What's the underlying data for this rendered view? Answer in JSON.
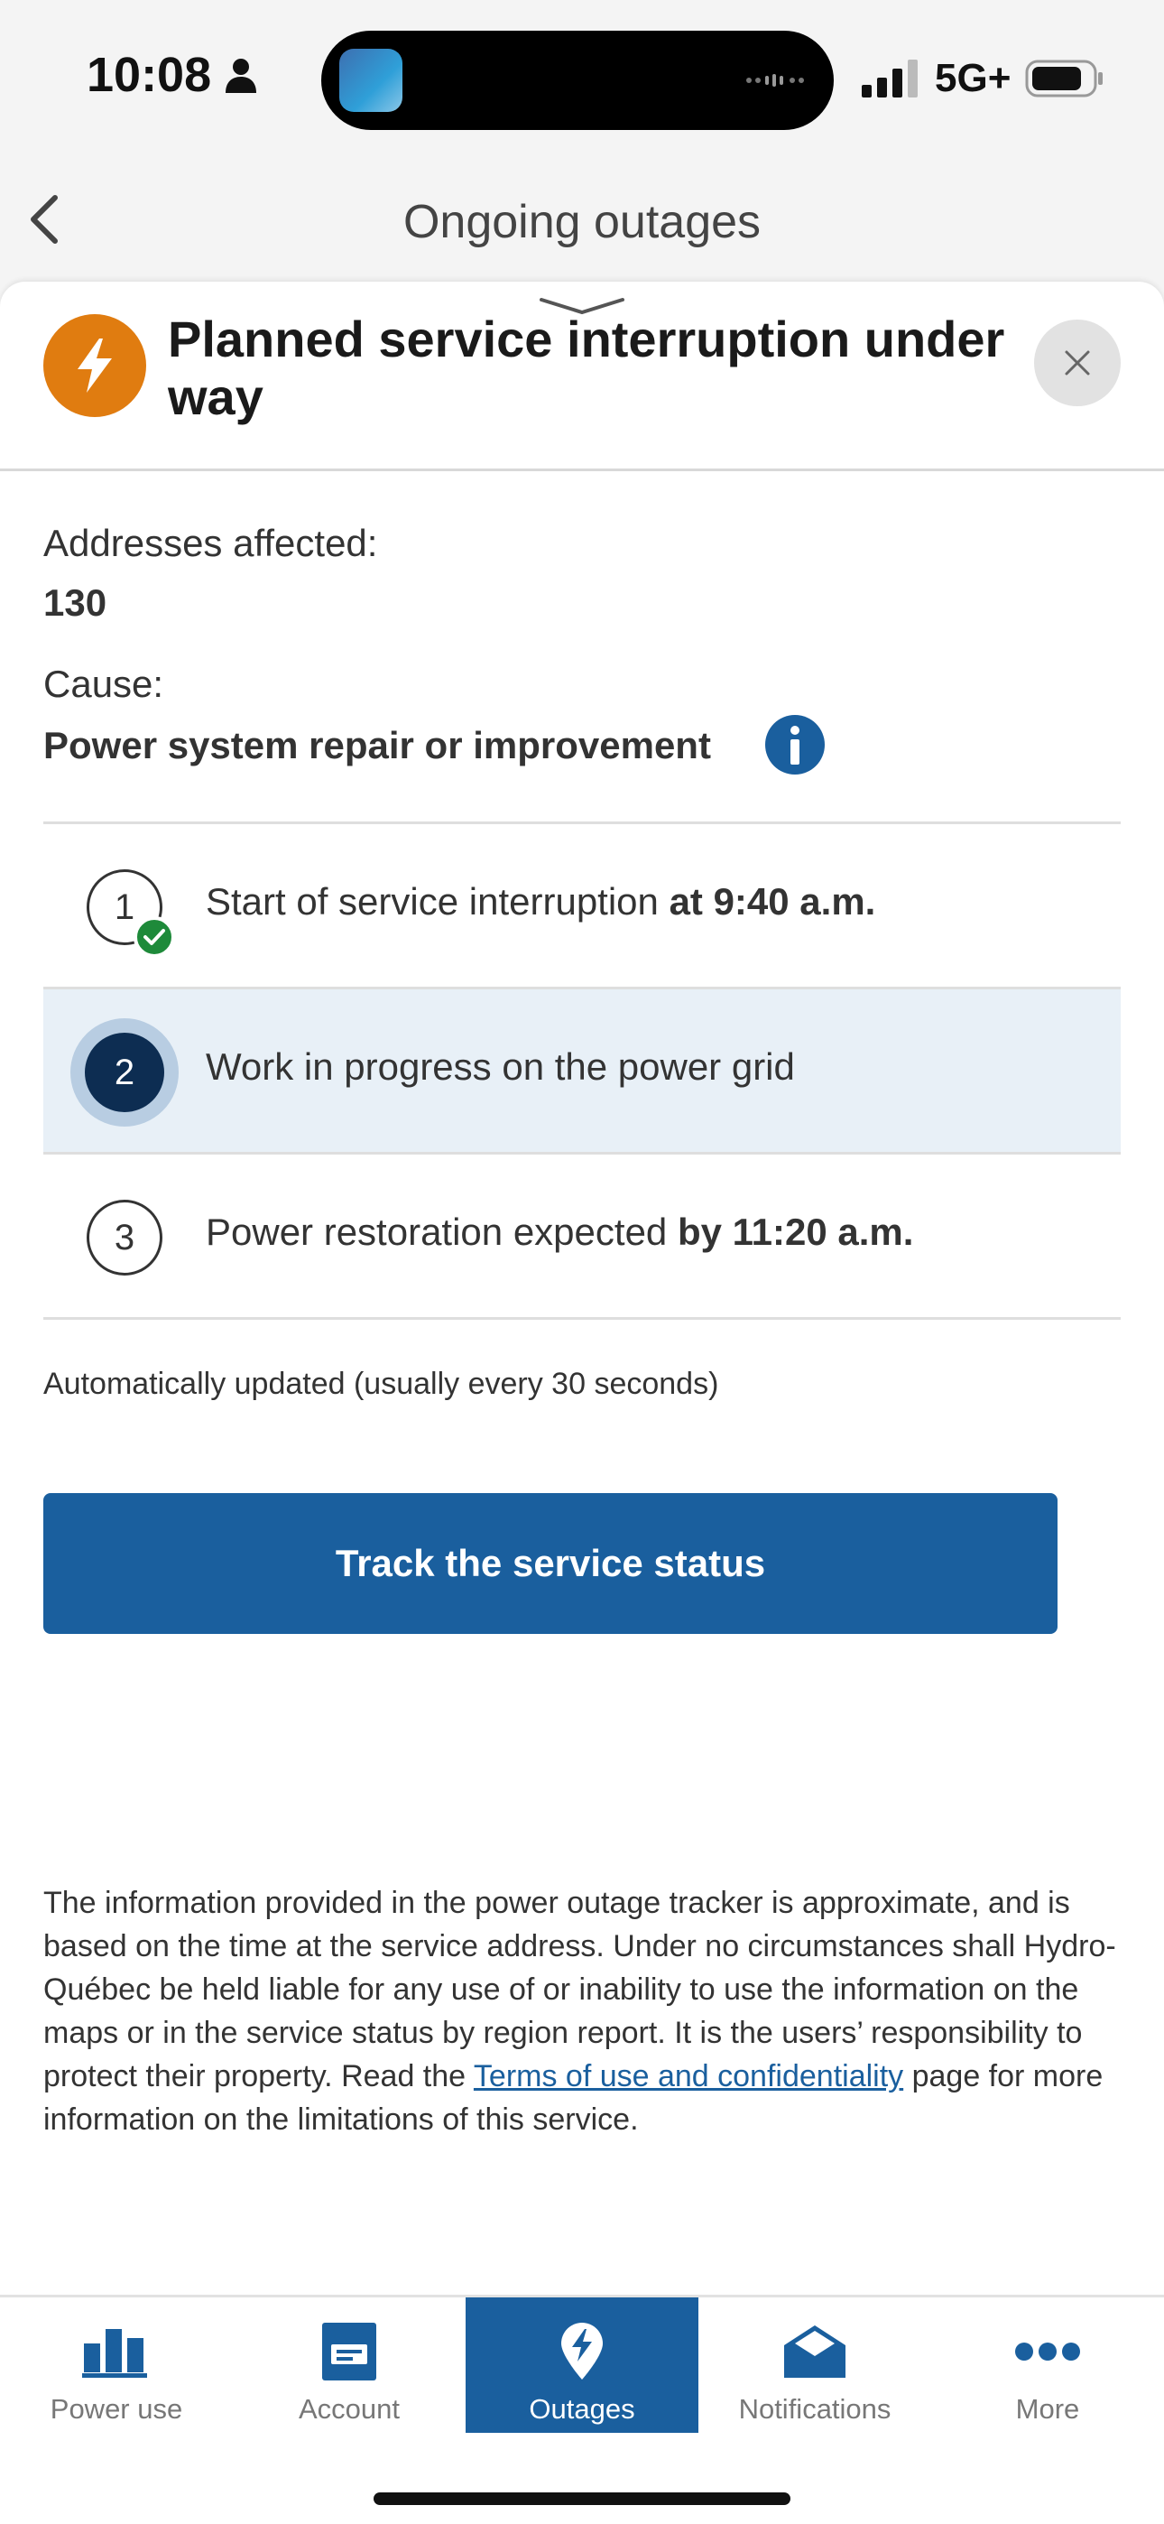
{
  "status_bar": {
    "time": "10:08",
    "network": "5G+"
  },
  "nav": {
    "title": "Ongoing outages"
  },
  "sheet": {
    "title": "Planned service interruption under way",
    "addresses_label": "Addresses affected:",
    "addresses_value": "130",
    "cause_label": "Cause:",
    "cause_value": "Power system repair or improvement",
    "steps": [
      {
        "number": "1",
        "text": "Start of service interruption ",
        "bold": "at 9:40 a.m.",
        "state": "done"
      },
      {
        "number": "2",
        "text": "Work in progress on the power grid",
        "bold": "",
        "state": "active"
      },
      {
        "number": "3",
        "text": "Power restoration expected ",
        "bold": "by 11:20 a.m.",
        "state": "pending"
      }
    ],
    "auto_update": "Automatically updated (usually every 30 seconds)",
    "track_button": "Track the service status",
    "disclaimer_before": "The information provided in the power outage tracker is approximate, and is based on the time at the service address. Under no circumstances shall Hydro-Québec be held liable for any use of or inability to use the information on the maps or in the service status by region report. It is the users’ responsibility to protect their property. Read the ",
    "disclaimer_link": "Terms of use and confidentiality",
    "disclaimer_after": " page for more information on the limitations of this service."
  },
  "tabs": [
    {
      "label": "Power use",
      "icon": "bar-chart-icon"
    },
    {
      "label": "Account",
      "icon": "account-icon"
    },
    {
      "label": "Outages",
      "icon": "outage-bolt-icon",
      "active": true
    },
    {
      "label": "Notifications",
      "icon": "envelope-icon"
    },
    {
      "label": "More",
      "icon": "more-dots-icon"
    }
  ],
  "colors": {
    "primary": "#1a5f9e",
    "accent_orange": "#e07c10",
    "success_green": "#1e8a3a",
    "active_step_bg": "#e8f0f7"
  }
}
